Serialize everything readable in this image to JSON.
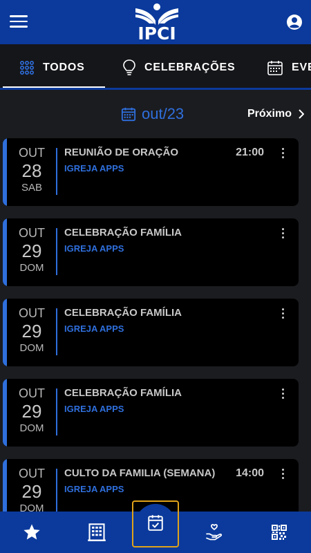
{
  "header": {
    "logo_text": "IPCI",
    "menu_icon": "hamburger-menu-icon",
    "account_icon": "account-circle-icon"
  },
  "tabs": [
    {
      "label": "TODOS",
      "icon": "grid-dots-icon",
      "active": true
    },
    {
      "label": "CELEBRAÇÕES",
      "icon": "lightbulb-icon",
      "active": false
    },
    {
      "label": "EVENTOS",
      "icon": "calendar-icon",
      "active": false
    }
  ],
  "month_nav": {
    "current": "out/23",
    "next_label": "Próximo"
  },
  "events": [
    {
      "month": "OUT",
      "day": "28",
      "weekday": "SAB",
      "title": "REUNIÃO DE ORAÇÃO",
      "org": "IGREJA APPS",
      "time": "21:00"
    },
    {
      "month": "OUT",
      "day": "29",
      "weekday": "DOM",
      "title": "CELEBRAÇÃO FAMÍLIA",
      "org": "IGREJA APPS",
      "time": ""
    },
    {
      "month": "OUT",
      "day": "29",
      "weekday": "DOM",
      "title": "CELEBRAÇÃO FAMÍLIA",
      "org": "IGREJA APPS",
      "time": ""
    },
    {
      "month": "OUT",
      "day": "29",
      "weekday": "DOM",
      "title": "CELEBRAÇÃO FAMÍLIA",
      "org": "IGREJA APPS",
      "time": ""
    },
    {
      "month": "OUT",
      "day": "29",
      "weekday": "DOM",
      "title": "CULTO DA FAMILIA (SEMANA)",
      "org": "IGREJA APPS",
      "time": "14:00"
    }
  ],
  "bottom_nav": [
    {
      "icon": "star-icon"
    },
    {
      "icon": "building-icon"
    },
    {
      "icon": "calendar-check-icon",
      "active": true
    },
    {
      "icon": "hand-heart-icon"
    },
    {
      "icon": "qr-code-icon"
    }
  ],
  "colors": {
    "brand_blue": "#0b3a9c",
    "accent_blue": "#2f6fdd",
    "background": "#1b1c20",
    "card": "#000000",
    "highlight_border": "#e0a31a"
  }
}
